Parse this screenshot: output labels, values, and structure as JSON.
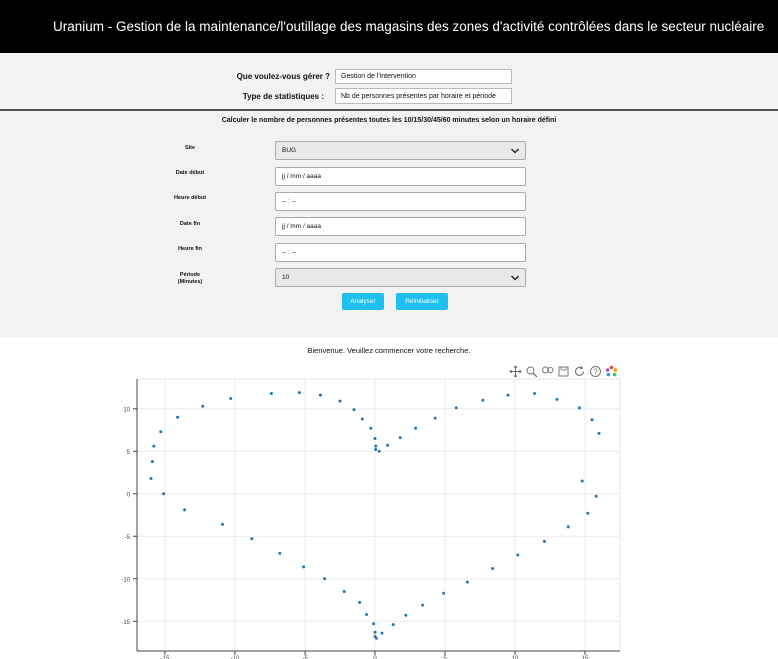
{
  "app": {
    "title": "Uranium - Gestion de la maintenance/l'outillage des magasins des zones d'activité contrôlées dans le secteur nucléaire"
  },
  "manage": {
    "question_label": "Que voulez-vous gérer ?",
    "question_value": "Gestion de l'intervention",
    "stats_label": "Type de statistiques :",
    "stats_value": "Nb de personnes présentes par horaire et période"
  },
  "form": {
    "title": "Calculer le nombre de personnes présentes toutes les 10/15/30/45/60 minutes selon un horaire défini",
    "site_label": "Site",
    "site_value": "BUG",
    "date_debut_label": "Date début",
    "date_debut_value": "jj / mm / aaaa",
    "heure_debut_label": "Heure début",
    "heure_debut_value": "-- : --",
    "date_fin_label": "Date fin",
    "date_fin_value": "jj / mm / aaaa",
    "heure_fin_label": "Heure fin",
    "heure_fin_value": "-- : --",
    "periode_label_1": "Période",
    "periode_label_2": "(Minutes)",
    "periode_value": "10",
    "analyse_button": "Analyser",
    "reset_button": "Réinitialiser"
  },
  "welcome": "Bienvenue. Veuillez commencer votre recherche.",
  "toolbar": {
    "icons": [
      "pan-icon",
      "box-zoom-icon",
      "wheel-zoom-icon",
      "save-icon",
      "reset-icon",
      "help-icon",
      "bokeh-logo-icon"
    ]
  },
  "colors": {
    "accent": "#1ec0f0",
    "point": "#1f77b4"
  },
  "chart_data": {
    "type": "scatter",
    "title": "",
    "xlabel": "",
    "ylabel": "",
    "xlim": [
      -17,
      17.5
    ],
    "ylim": [
      -18.5,
      13.5
    ],
    "grid": true,
    "xticks": [
      -15,
      -10,
      -5,
      0,
      5,
      10,
      15
    ],
    "yticks": [
      -15,
      -10,
      -5,
      0,
      5,
      10
    ],
    "series": [
      {
        "x": [
          -15.9,
          -16.0,
          -15.8,
          -15.3,
          -15.1,
          -14.1,
          -13.6,
          -12.3,
          -10.9,
          -10.3,
          -8.8,
          -7.4,
          -6.8,
          -5.4,
          -5.1,
          -3.9,
          -3.6,
          -2.5,
          -2.2,
          -1.5,
          -1.1,
          -0.9,
          -0.6,
          -0.3,
          -0.1,
          0.0,
          0.0,
          0.05,
          0.0,
          0.05,
          0.1,
          0.3,
          0.5,
          0.9,
          1.3,
          1.8,
          2.2,
          2.9,
          3.4,
          4.3,
          4.9,
          5.8,
          6.6,
          7.7,
          8.4,
          9.5,
          10.2,
          11.4,
          12.1,
          13.0,
          13.8,
          14.6,
          15.2,
          15.5,
          15.8,
          16.0,
          14.8
        ],
        "y": [
          3.8,
          1.8,
          5.6,
          7.3,
          0.0,
          9.0,
          -1.9,
          10.3,
          -3.6,
          11.2,
          -5.3,
          11.8,
          -7.0,
          11.9,
          -8.6,
          11.6,
          -10.0,
          10.9,
          -11.5,
          9.9,
          -12.8,
          8.8,
          -14.2,
          7.7,
          -15.3,
          6.5,
          -16.3,
          5.6,
          -16.8,
          5.2,
          -17.0,
          5.0,
          -16.4,
          5.7,
          -15.4,
          6.6,
          -14.3,
          7.7,
          -13.1,
          8.9,
          -11.7,
          10.1,
          -10.4,
          11.0,
          -8.8,
          11.6,
          -7.2,
          11.8,
          -5.6,
          11.1,
          -3.9,
          10.1,
          -2.3,
          8.7,
          -0.3,
          7.1,
          1.5
        ]
      }
    ]
  }
}
